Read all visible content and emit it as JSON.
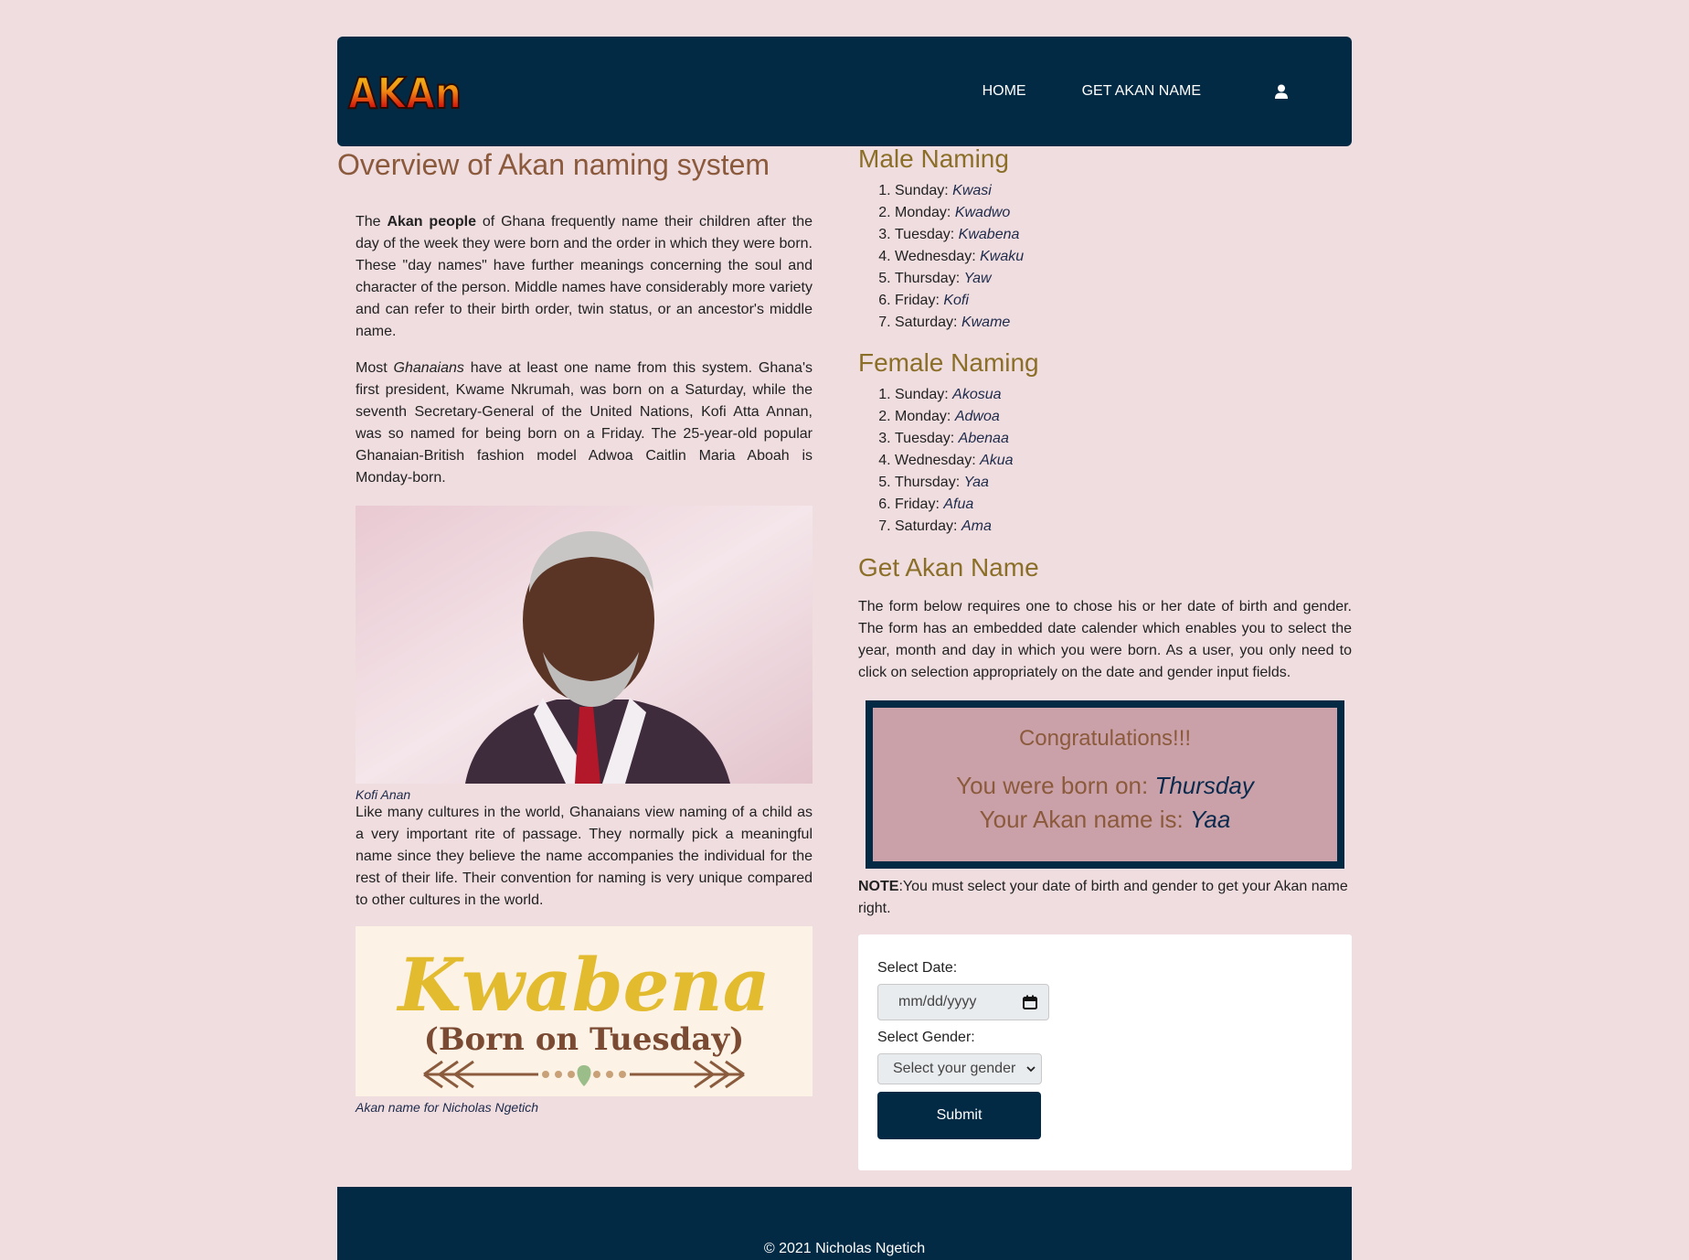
{
  "brand": {
    "logo_text": "AKAN"
  },
  "nav": {
    "home": "HOME",
    "get_name": "GET AKAN NAME",
    "user_icon": "user-icon"
  },
  "overview": {
    "title": "Overview of Akan naming system",
    "p1_before": "The ",
    "p1_bold": "Akan people",
    "p1_after": " of Ghana frequently name their children after the day of the week they were born and the order in which they were born. These \"day names\" have further meanings concerning the soul and character of the person. Middle names have considerably more variety and can refer to their birth order, twin status, or an ancestor's middle name.",
    "p2_before": "Most ",
    "p2_italic": "Ghanaians",
    "p2_after": " have at least one name from this system. Ghana's first president, Kwame Nkrumah, was born on a Saturday, while the seventh Secretary-General of the United Nations, Kofi Atta Annan, was so named for being born on a Friday. The 25-year-old popular Ghanaian-British fashion model Adwoa Caitlin Maria Aboah is Monday-born.",
    "photo_caption": "Kofi Anan",
    "p3": "Like many cultures in the world, Ghanaians view naming of a child as a very important rite of passage. They normally pick a meaningful name since they believe the name accompanies the individual for the rest of their life. Their convention for naming is very unique compared to other cultures in the world.",
    "banner_name": "Kwabena",
    "banner_sub": "(Born on Tuesday)",
    "banner_caption": "Akan name for Nicholas Ngetich"
  },
  "male": {
    "title": "Male Naming",
    "items": [
      {
        "day": "Sunday: ",
        "name": "Kwasi"
      },
      {
        "day": "Monday: ",
        "name": "Kwadwo"
      },
      {
        "day": "Tuesday: ",
        "name": "Kwabena"
      },
      {
        "day": "Wednesday: ",
        "name": "Kwaku"
      },
      {
        "day": "Thursday: ",
        "name": "Yaw"
      },
      {
        "day": "Friday: ",
        "name": "Kofi"
      },
      {
        "day": "Saturday: ",
        "name": "Kwame"
      }
    ]
  },
  "female": {
    "title": "Female Naming",
    "items": [
      {
        "day": "Sunday: ",
        "name": "Akosua"
      },
      {
        "day": "Monday: ",
        "name": "Adwoa"
      },
      {
        "day": "Tuesday: ",
        "name": "Abenaa"
      },
      {
        "day": "Wednesday: ",
        "name": "Akua"
      },
      {
        "day": "Thursday: ",
        "name": "Yaa"
      },
      {
        "day": "Friday: ",
        "name": "Afua"
      },
      {
        "day": "Saturday: ",
        "name": "Ama"
      }
    ]
  },
  "get": {
    "title": "Get Akan Name",
    "description": "The form below requires one to chose his or her date of birth and gender. The form has an embedded date calender which enables you to select the year, month and day in which you were born. As a user, you only need to click on selection appropriately on the date and gender input fields."
  },
  "result": {
    "congrats": "Congratulations!!!",
    "born_prefix": "You were born on: ",
    "born_day": "Thursday",
    "name_prefix": "Your Akan name is: ",
    "name_value": "Yaa"
  },
  "note": {
    "label": "NOTE",
    "text": ":You must select your date of birth and gender to get your Akan name right."
  },
  "form": {
    "date_label": "Select Date:",
    "date_placeholder": "mm/dd/yyyy",
    "gender_label": "Select Gender:",
    "gender_selected": "Select your gender",
    "submit": "Submit"
  },
  "footer": {
    "text": "© 2021 Nicholas Ngetich"
  }
}
